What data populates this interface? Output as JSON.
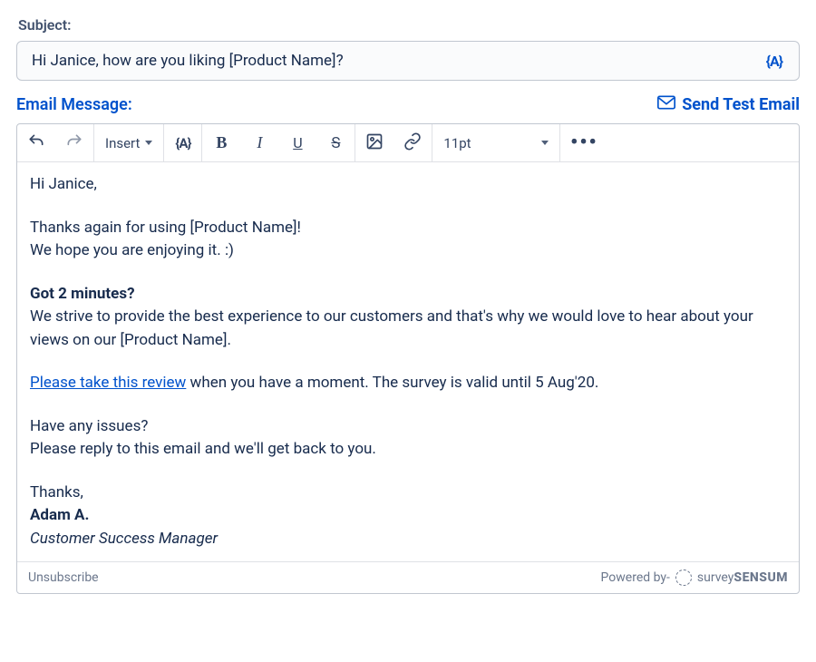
{
  "subject": {
    "label": "Subject:",
    "value": "Hi Janice, how are you liking [Product Name]?",
    "token_button": "{A}"
  },
  "header": {
    "email_message_label": "Email Message:",
    "send_test_label": "Send Test Email"
  },
  "toolbar": {
    "insert_label": "Insert",
    "token": "{A}",
    "bold": "B",
    "italic": "I",
    "underline": "U",
    "strike": "S",
    "font_size": "11pt",
    "more": "•••"
  },
  "body": {
    "greeting": "Hi Janice,",
    "p1a": "Thanks again for using [Product Name]!",
    "p1b": "We hope you are enjoying it. :)",
    "p2_heading": "Got 2 minutes?",
    "p2": "We strive to provide the best experience to our customers and that's why we would love to hear about your views on our [Product Name].",
    "p3_link": "Please take this review",
    "p3_rest": " when you have a moment. The survey is valid until 5 Aug'20.",
    "p4a": "Have any issues?",
    "p4b": "Please reply to this email and we'll get back to you.",
    "signoff": "Thanks,",
    "name": "Adam A.",
    "title": "Customer Success Manager"
  },
  "footer": {
    "unsubscribe": "Unsubscribe",
    "powered_by": "Powered by-",
    "brand1": "survey",
    "brand2": "SENSUM"
  }
}
